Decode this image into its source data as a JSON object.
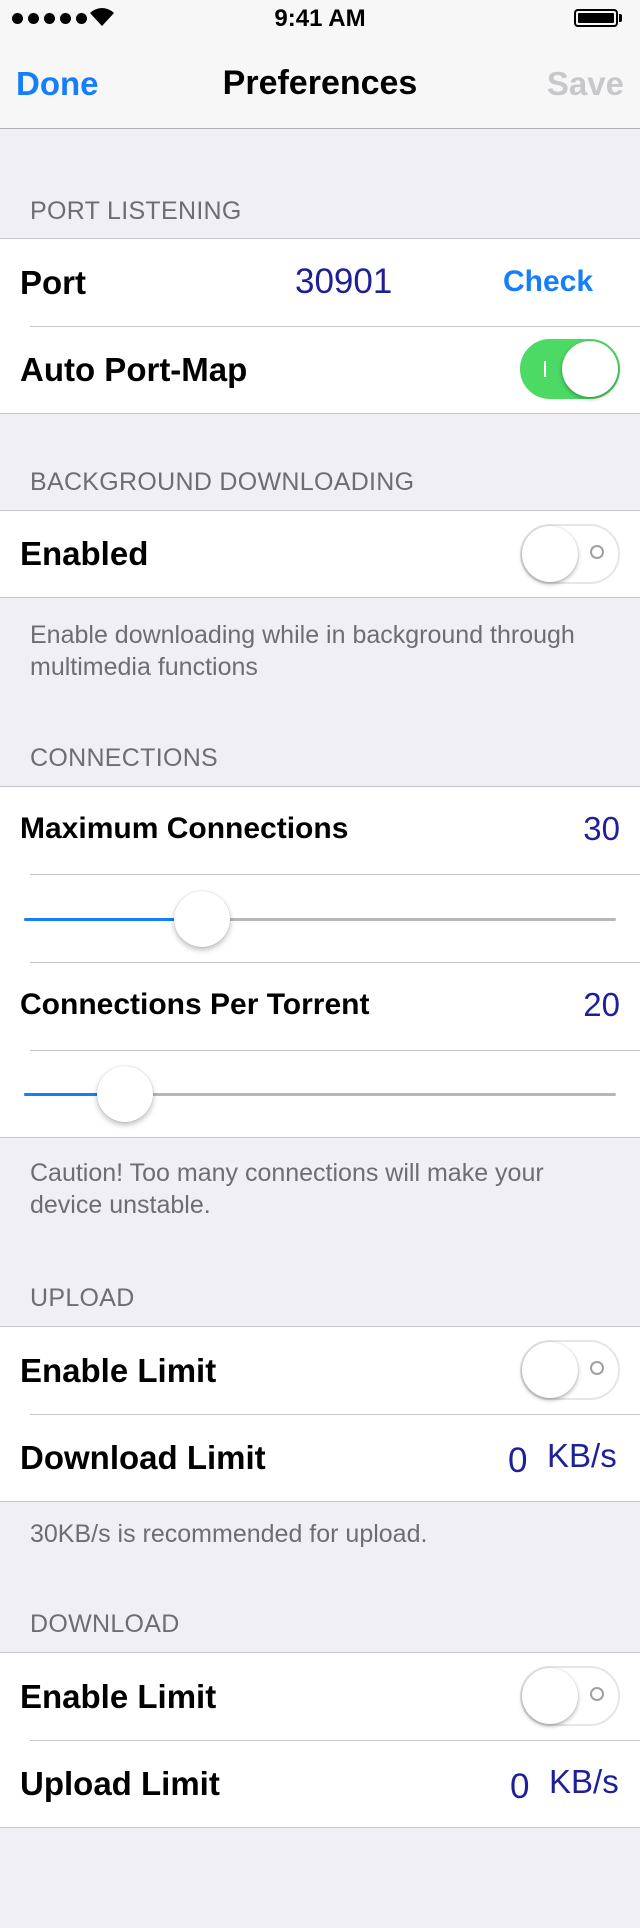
{
  "status_bar": {
    "time": "9:41 AM"
  },
  "nav": {
    "done_label": "Done",
    "title": "Preferences",
    "save_label": "Save"
  },
  "port_listening": {
    "header": "PORT LISTENING",
    "port_label": "Port",
    "port_value": "30901",
    "check_label": "Check",
    "auto_port_map_label": "Auto Port-Map",
    "auto_port_map_on": true
  },
  "background_downloading": {
    "header": "BACKGROUND DOWNLOADING",
    "enabled_label": "Enabled",
    "enabled_on": false,
    "footer": "Enable downloading while in background through multimedia functions"
  },
  "connections": {
    "header": "CONNECTIONS",
    "max_label": "Maximum Connections",
    "max_value": "30",
    "max_slider_fraction": 0.3,
    "per_torrent_label": "Connections Per Torrent",
    "per_torrent_value": "20",
    "per_torrent_slider_fraction": 0.17,
    "footer": "Caution! Too many connections will make your device unstable."
  },
  "upload": {
    "header": "UPLOAD",
    "enable_limit_label": "Enable Limit",
    "enable_limit_on": false,
    "limit_label": "Download Limit",
    "limit_value": "0",
    "limit_unit": "KB/s",
    "footer": "30KB/s is recommended for upload."
  },
  "download": {
    "header": "DOWNLOAD",
    "enable_limit_label": "Enable Limit",
    "enable_limit_on": false,
    "limit_label": "Upload Limit",
    "limit_value": "0",
    "limit_unit": "KB/s"
  },
  "colors": {
    "accent": "#147efb",
    "value_text": "#1f1f99",
    "toggle_on": "#4cd964",
    "background": "#efeff4"
  }
}
